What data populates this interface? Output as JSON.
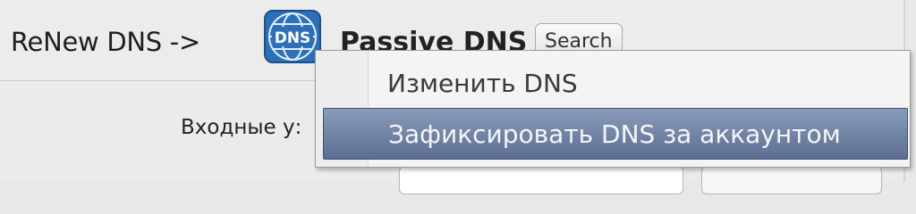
{
  "header": {
    "renew_label": "ReNew DNS ->",
    "dns_icon_text": "DNS",
    "passive_label": "Passive DNS",
    "search_button": "Search"
  },
  "form": {
    "input_label": "Входные у:"
  },
  "context_menu": {
    "items": [
      {
        "label": "Изменить DNS",
        "selected": false
      },
      {
        "label": "Зафиксировать DNS за аккаунтом",
        "selected": true
      }
    ]
  },
  "colors": {
    "menu_highlight": "#6e80a3",
    "dns_icon_blue": "#2f6fb8"
  }
}
